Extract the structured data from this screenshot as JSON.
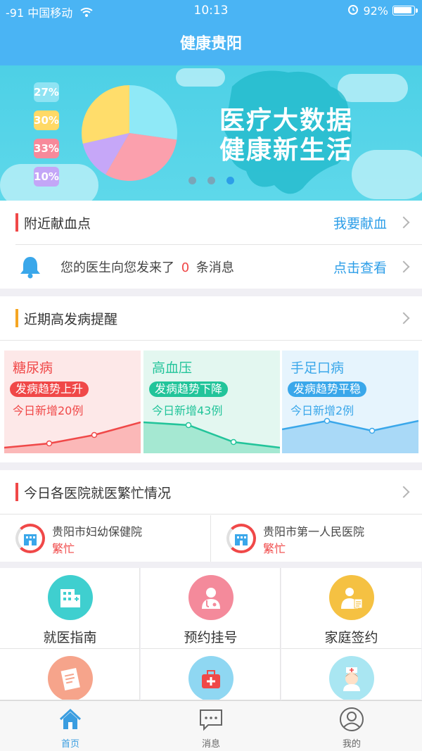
{
  "status": {
    "carrier": "-91 中国移动",
    "time": "10:13",
    "battery": "92%"
  },
  "nav": {
    "title": "健康贵阳"
  },
  "banner": {
    "legend": [
      "27%",
      "30%",
      "33%",
      "10%"
    ],
    "line1": "医疗大数据",
    "line2": "健康新生活",
    "slide_index": 3,
    "slide_count": 3
  },
  "blood": {
    "title": "附近献血点",
    "link": "我要献血"
  },
  "message": {
    "prefix": "您的医生向您发来了",
    "count": "0",
    "suffix": "条消息",
    "link": "点击查看"
  },
  "disease_section": {
    "title": "近期高发病提醒"
  },
  "diseases": [
    {
      "name": "糖尿病",
      "trend": "发病趋势上升",
      "new_cases": "今日新增20例",
      "color": "#f04848",
      "bg": "#fde8e8"
    },
    {
      "name": "高血压",
      "trend": "发病趋势下降",
      "new_cases": "今日新增43例",
      "color": "#22c49a",
      "bg": "#e3f7f0"
    },
    {
      "name": "手足口病",
      "trend": "发病趋势平稳",
      "new_cases": "今日新增2例",
      "color": "#3aa7ea",
      "bg": "#e6f4fd"
    }
  ],
  "hospital_section": {
    "title": "今日各医院就医繁忙情况"
  },
  "hospitals": [
    {
      "name": "贵阳市妇幼保健院",
      "status": "繁忙"
    },
    {
      "name": "贵阳市第一人民医院",
      "status": "繁忙"
    }
  ],
  "services": [
    {
      "label": "就医指南",
      "icon": "hospital-building-icon",
      "color": "#3fcfcf"
    },
    {
      "label": "预约挂号",
      "icon": "doctor-icon",
      "color": "#f48a9b"
    },
    {
      "label": "家庭签约",
      "icon": "family-doctor-icon",
      "color": "#f5c142"
    },
    {
      "label": "",
      "icon": "clipboard-icon",
      "color": "#f6a48b"
    },
    {
      "label": "",
      "icon": "medical-kit-icon",
      "color": "#8fd7f2"
    },
    {
      "label": "",
      "icon": "nurse-icon",
      "color": "#a9e6f2"
    }
  ],
  "tabs": [
    {
      "label": "首页",
      "icon": "home-icon",
      "active": true
    },
    {
      "label": "消息",
      "icon": "message-icon",
      "active": false
    },
    {
      "label": "我的",
      "icon": "profile-icon",
      "active": false
    }
  ]
}
